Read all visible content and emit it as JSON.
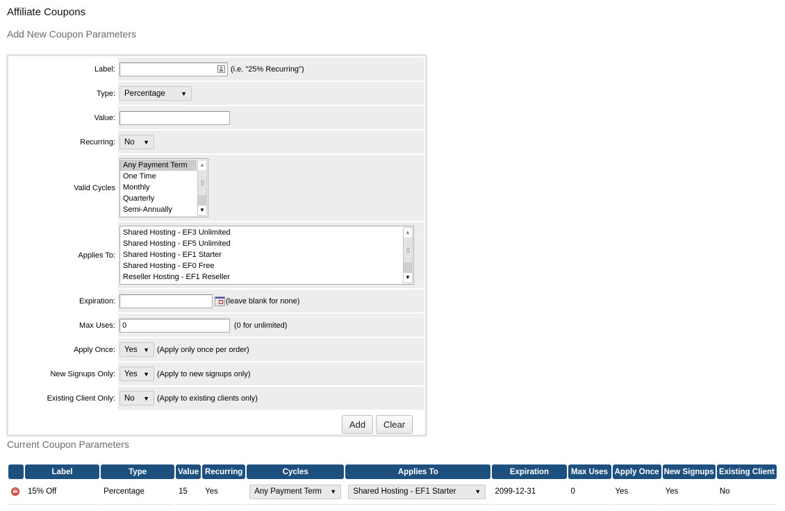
{
  "page": {
    "title": "Affiliate Coupons",
    "add_section_title": "Add New Coupon Parameters",
    "current_section_title": "Current Coupon Parameters"
  },
  "form": {
    "label": {
      "label": "Label:",
      "value": "",
      "hint": "(i.e. \"25% Recurring\")",
      "icon": "contact-card-icon"
    },
    "type": {
      "label": "Type:",
      "selected": "Percentage"
    },
    "value": {
      "label": "Value:",
      "value": ""
    },
    "recurring": {
      "label": "Recurring:",
      "selected": "No"
    },
    "valid_cycles": {
      "label": "Valid Cycles",
      "options": [
        "Any Payment Term",
        "One Time",
        "Monthly",
        "Quarterly",
        "Semi-Annually"
      ],
      "selected": "Any Payment Term"
    },
    "applies_to": {
      "label": "Applies To:",
      "options": [
        "Shared Hosting - EF3 Unlimited",
        "Shared Hosting - EF5 Unlimited",
        "Shared Hosting - EF1 Starter",
        "Shared Hosting - EF0 Free",
        "Reseller Hosting - EF1 Reseller"
      ]
    },
    "expiration": {
      "label": "Expiration:",
      "value": "",
      "hint": "(leave blank for none)",
      "icon": "calendar-icon"
    },
    "max_uses": {
      "label": "Max Uses:",
      "value": "0",
      "hint": "(0 for unlimited)"
    },
    "apply_once": {
      "label": "Apply Once:",
      "selected": "Yes",
      "hint": "(Apply only once per order)"
    },
    "new_signups_only": {
      "label": "New Signups Only:",
      "selected": "Yes",
      "hint": "(Apply to new signups only)"
    },
    "existing_client_only": {
      "label": "Existing Client Only:",
      "selected": "No",
      "hint": "(Apply to existing clients only)"
    },
    "buttons": {
      "add": "Add",
      "clear": "Clear"
    }
  },
  "table": {
    "headers": [
      "",
      "Label",
      "Type",
      "Value",
      "Recurring",
      "Cycles",
      "Applies To",
      "Expiration",
      "Max Uses",
      "Apply Once",
      "New Signups",
      "Existing Client"
    ],
    "rows": [
      {
        "delete_icon": "delete-icon",
        "label": "15% Off",
        "type": "Percentage",
        "value": "15",
        "recurring": "Yes",
        "cycles": "Any Payment Term",
        "applies_to": "Shared Hosting - EF1 Starter",
        "expiration": "2099-12-31",
        "max_uses": "0",
        "apply_once": "Yes",
        "new_signups": "Yes",
        "existing_client": "No"
      }
    ]
  },
  "colors": {
    "header_bg": "#1d4f7f",
    "row_bg": "#ededed",
    "delete_red": "#d63b2f"
  }
}
